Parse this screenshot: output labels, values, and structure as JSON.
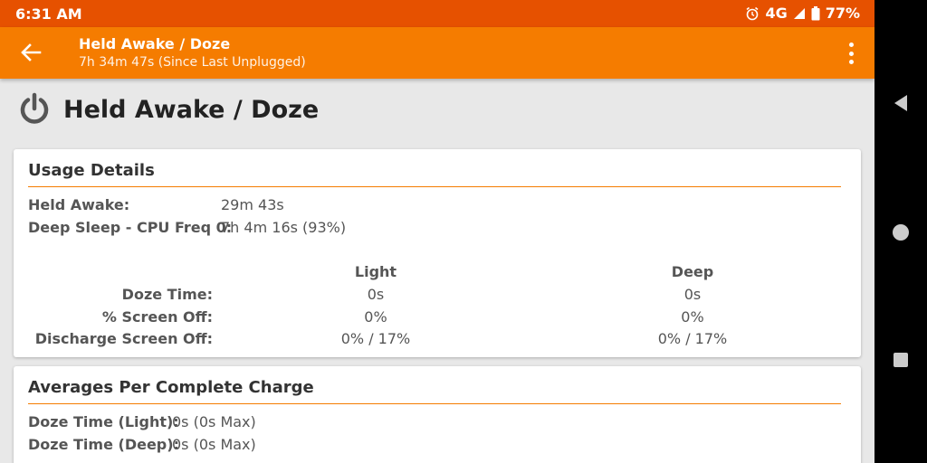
{
  "status_bar": {
    "time": "6:31 AM",
    "network": "4G",
    "battery": "77%",
    "icons": [
      "alarm-icon",
      "signal-icon",
      "battery-icon"
    ]
  },
  "app_bar": {
    "title": "Held Awake / Doze",
    "subtitle": "7h 34m 47s (Since Last Unplugged)"
  },
  "page": {
    "heading": "Held Awake / Doze",
    "icon": "power-icon"
  },
  "usage_details": {
    "title": "Usage Details",
    "rows": [
      {
        "label": "Held Awake:",
        "value": "29m 43s"
      },
      {
        "label": "Deep Sleep - CPU Freq 0:",
        "value": "7h 4m 16s (93%)"
      }
    ],
    "table": {
      "columns": [
        "Light",
        "Deep"
      ],
      "rows": [
        {
          "label": "Doze Time:",
          "light": "0s",
          "deep": "0s"
        },
        {
          "label": "% Screen Off:",
          "light": "0%",
          "deep": "0%"
        },
        {
          "label": "Discharge Screen Off:",
          "light": "0% / 17%",
          "deep": "0% / 17%"
        }
      ]
    }
  },
  "averages": {
    "title": "Averages Per Complete Charge",
    "rows": [
      {
        "label": "Doze Time (Light):",
        "value": "0s (0s Max)"
      },
      {
        "label": "Doze Time (Deep):",
        "value": "0s (0s Max)"
      }
    ]
  },
  "colors": {
    "status_bar": "#e65100",
    "app_bar": "#f57c00",
    "accent_rule": "#f57c00",
    "background": "#e8e8e8"
  }
}
